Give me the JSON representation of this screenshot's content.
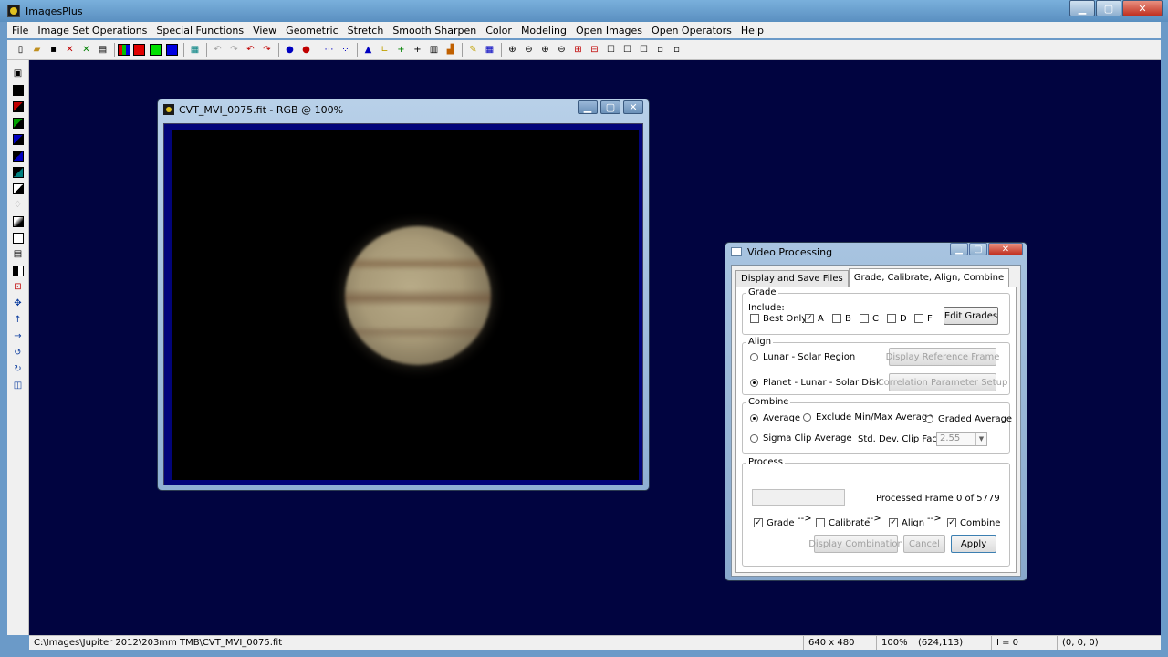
{
  "app": {
    "title": "ImagesPlus"
  },
  "menu": [
    "File",
    "Image Set Operations",
    "Special Functions",
    "View",
    "Geometric",
    "Stretch",
    "Smooth Sharpen",
    "Color",
    "Modeling",
    "Open Images",
    "Open Operators",
    "Help"
  ],
  "toolbar": {
    "color_swatches": [
      "#e00000",
      "#00c000",
      "#0000e0"
    ]
  },
  "image_window": {
    "title": "CVT_MVI_0075.fit - RGB @ 100%"
  },
  "dialog": {
    "title": "Video Processing",
    "tabs": [
      "Display and Save Files",
      "Grade, Calibrate, Align, Combine"
    ],
    "grade": {
      "label": "Grade",
      "include_label": "Include:",
      "options": [
        {
          "label": "Best Only",
          "checked": false
        },
        {
          "label": "A",
          "checked": true
        },
        {
          "label": "B",
          "checked": false
        },
        {
          "label": "C",
          "checked": false
        },
        {
          "label": "D",
          "checked": false
        },
        {
          "label": "F",
          "checked": false
        }
      ],
      "edit_button": "Edit Grades"
    },
    "align": {
      "label": "Align",
      "option_region": "Lunar - Solar Region",
      "option_disk": "Planet - Lunar - Solar Disk",
      "display_ref_button": "Display Reference Frame",
      "corr_param_button": "Correlation Parameter Setup"
    },
    "combine": {
      "label": "Combine",
      "average": "Average",
      "exclude_minmax": "Exclude Min/Max Average",
      "graded_average": "Graded Average",
      "sigma_clip": "Sigma Clip Average",
      "std_dev_label": "Std. Dev. Clip Factor:",
      "std_dev_value": "2.55"
    },
    "process": {
      "label": "Process",
      "status": "Processed Frame 0 of 5779",
      "arrow": "-->",
      "steps": [
        {
          "label": "Grade",
          "checked": true
        },
        {
          "label": "Calibrate",
          "checked": false
        },
        {
          "label": "Align",
          "checked": true
        },
        {
          "label": "Combine",
          "checked": true
        }
      ],
      "display_combination_button": "Display Combination",
      "cancel_button": "Cancel",
      "apply_button": "Apply"
    }
  },
  "status": {
    "path": "C:\\Images\\Jupiter 2012\\203mm TMB\\CVT_MVI_0075.fit",
    "dimensions": "640 x 480",
    "zoom": "100%",
    "coords": "(624,113)",
    "intensity": "I = 0",
    "rgb": "(0, 0, 0)"
  }
}
